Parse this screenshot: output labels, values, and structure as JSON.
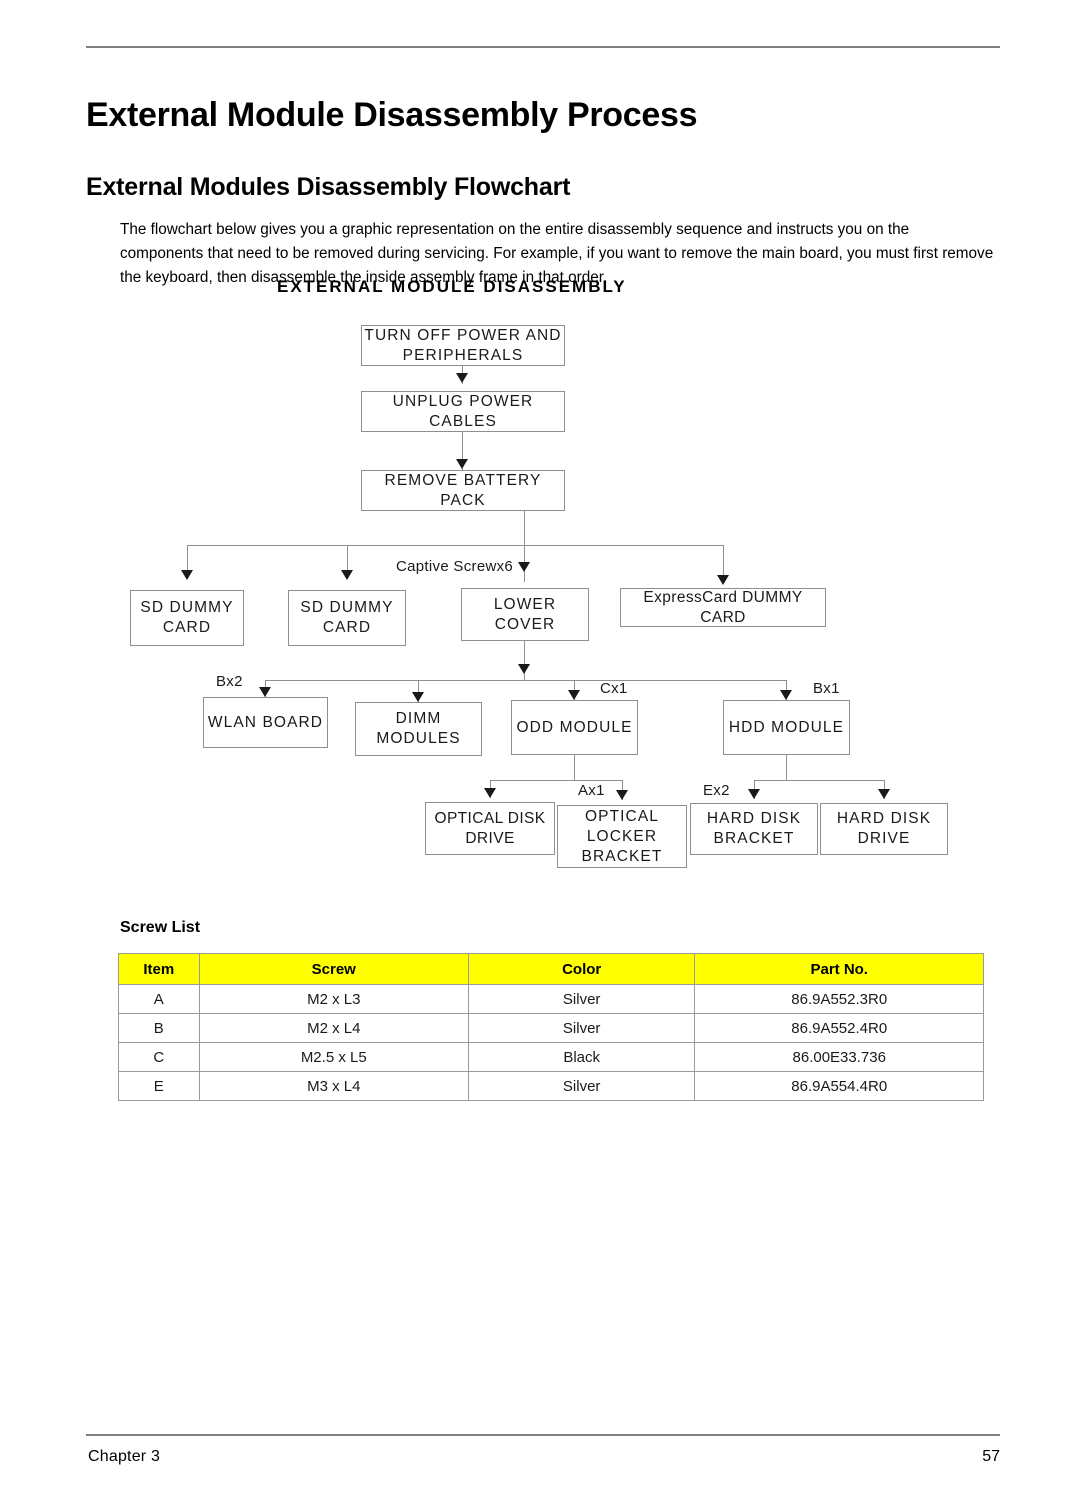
{
  "page": {
    "heading": "External Module Disassembly Process",
    "subheading": "External Modules Disassembly Flowchart",
    "intro": "The flowchart below gives you a graphic representation on the entire disassembly sequence and instructs you on the components that need to be removed during servicing. For example, if you want to remove the main board, you must first remove the keyboard, then disassemble the inside assembly frame in that order.",
    "footer_left": "Chapter 3",
    "footer_right": "57"
  },
  "flowchart": {
    "title": "EXTERNAL MODULE DISASSEMBLY",
    "nodes": {
      "turn_off_power": "TURN OFF POWER AND PERIPHERALS",
      "unplug_power": "UNPLUG POWER CABLES",
      "remove_battery": "REMOVE BATTERY PACK",
      "sd_dummy_card_1": "SD DUMMY CARD",
      "sd_dummy_card_2": "SD DUMMY CARD",
      "lower_cover": "LOWER COVER",
      "expresscard_dummy": "ExpressCard DUMMY CARD",
      "wlan_board": "WLAN BOARD",
      "dimm_modules": "DIMM MODULES",
      "odd_module": "ODD MODULE",
      "hdd_module": "HDD MODULE",
      "optical_disk_drive": "OPTICAL DISK DRIVE",
      "optical_locker_bracket": "OPTICAL LOCKER BRACKET",
      "hard_disk_bracket": "HARD DISK BRACKET",
      "hard_disk_drive": "HARD DISK DRIVE"
    },
    "edge_labels": {
      "captive_screw": "Captive Screwx6",
      "wlan_screw": "Bx2",
      "odd_screw": "Cx1",
      "hdd_screw": "Bx1",
      "optical_locker_screw": "Ax1",
      "hard_disk_screw": "Ex2"
    }
  },
  "screw_list": {
    "title": "Screw List",
    "header_color": "#FFFF00",
    "columns": [
      "Item",
      "Screw",
      "Color",
      "Part No."
    ],
    "rows": [
      {
        "item": "A",
        "screw": "M2 x L3",
        "color": "Silver",
        "part_no": "86.9A552.3R0"
      },
      {
        "item": "B",
        "screw": "M2 x L4",
        "color": "Silver",
        "part_no": "86.9A552.4R0"
      },
      {
        "item": "C",
        "screw": "M2.5 x L5",
        "color": "Black",
        "part_no": "86.00E33.736"
      },
      {
        "item": "E",
        "screw": "M3 x L4",
        "color": "Silver",
        "part_no": "86.9A554.4R0"
      }
    ]
  }
}
